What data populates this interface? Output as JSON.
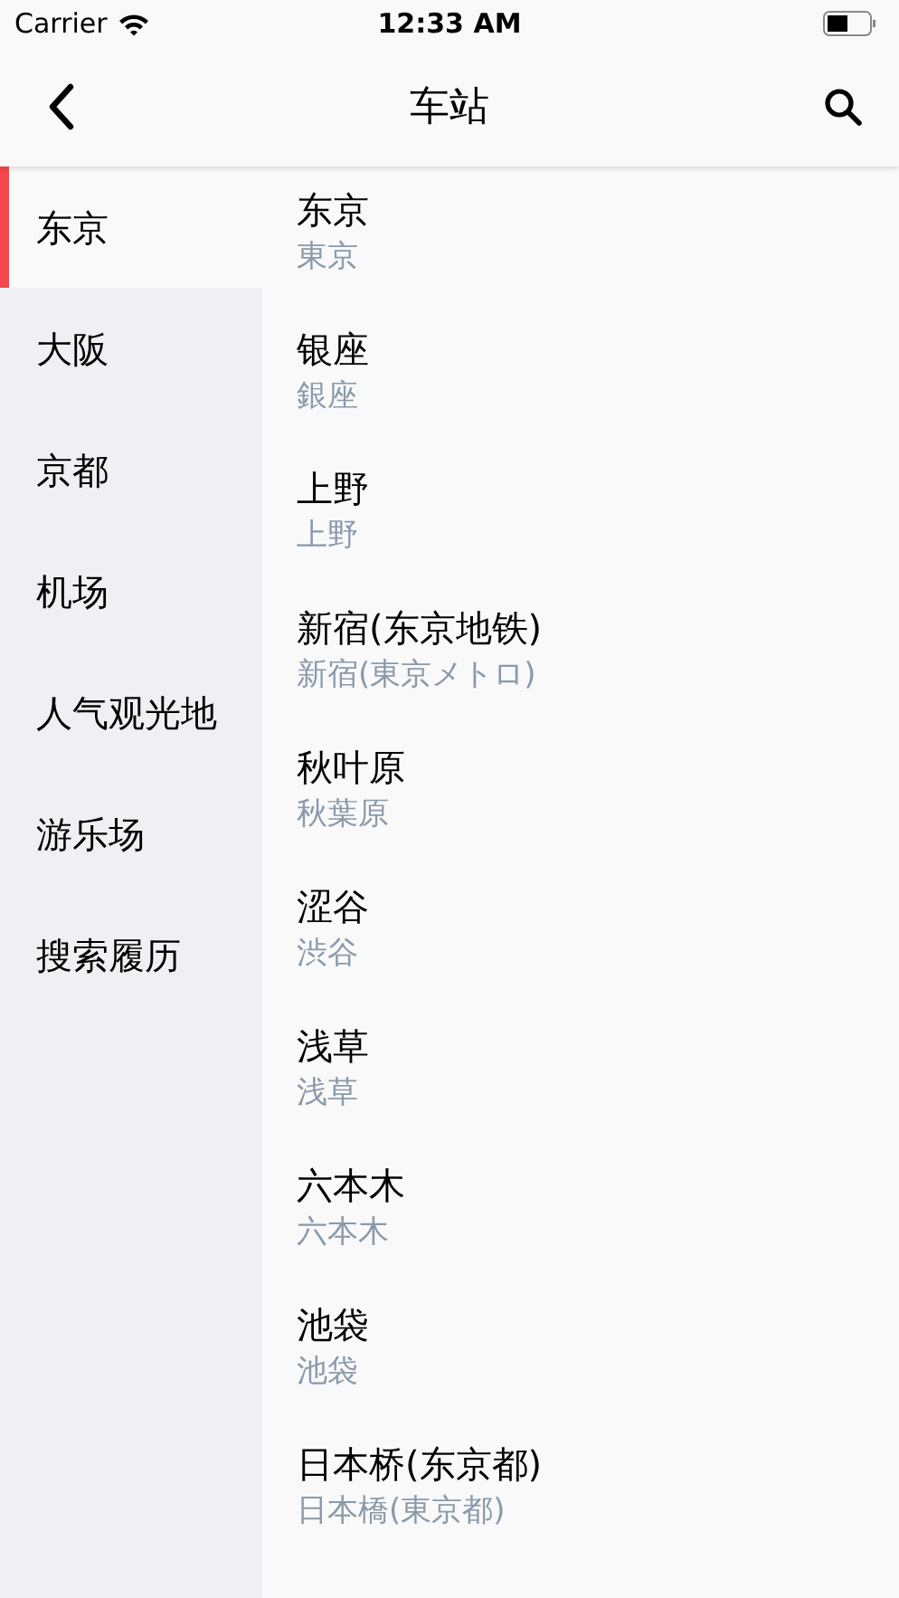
{
  "status_bar": {
    "carrier": "Carrier",
    "time": "12:33 AM"
  },
  "nav": {
    "title": "车站"
  },
  "sidebar": {
    "items": [
      {
        "label": "东京",
        "selected": true
      },
      {
        "label": "大阪",
        "selected": false
      },
      {
        "label": "京都",
        "selected": false
      },
      {
        "label": "机场",
        "selected": false
      },
      {
        "label": "人气观光地",
        "selected": false
      },
      {
        "label": "游乐场",
        "selected": false
      },
      {
        "label": "搜索履历",
        "selected": false
      }
    ]
  },
  "stations": [
    {
      "name": "东京",
      "subtitle": "東京"
    },
    {
      "name": "银座",
      "subtitle": "銀座"
    },
    {
      "name": "上野",
      "subtitle": "上野"
    },
    {
      "name": "新宿(东京地铁)",
      "subtitle": "新宿(東京メトロ)"
    },
    {
      "name": "秋叶原",
      "subtitle": "秋葉原"
    },
    {
      "name": "涩谷",
      "subtitle": "渋谷"
    },
    {
      "name": "浅草",
      "subtitle": "浅草"
    },
    {
      "name": "六本木",
      "subtitle": "六本木"
    },
    {
      "name": "池袋",
      "subtitle": "池袋"
    },
    {
      "name": "日本桥(东京都)",
      "subtitle": "日本橋(東京都)"
    }
  ]
}
